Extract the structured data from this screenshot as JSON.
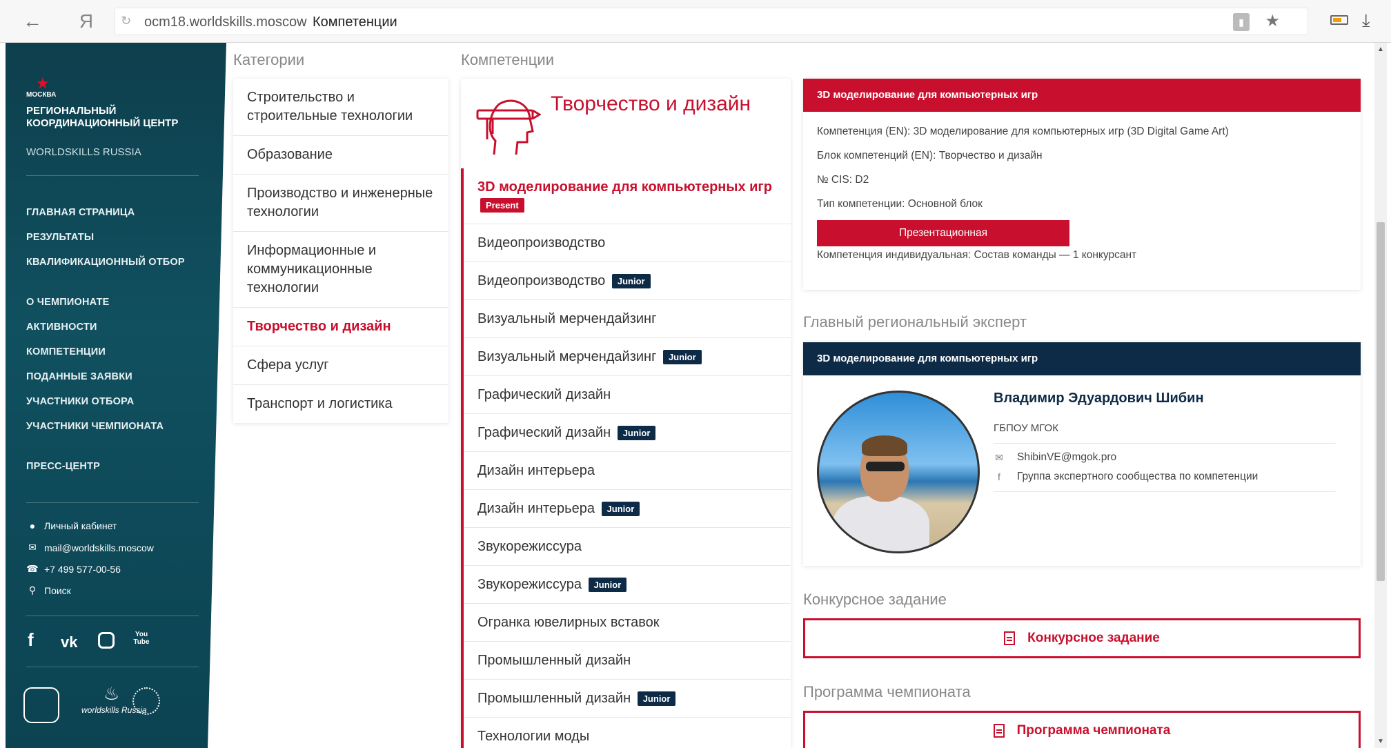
{
  "browser": {
    "back": "←",
    "ya": "Я",
    "url_host": "ocm18.worldskills.moscow",
    "url_title": "Компетенции"
  },
  "sidebar": {
    "logo_city": "МОСКВА",
    "logo_title": "РЕГИОНАЛЬНЫЙ КООРДИНАЦИОННЫЙ ЦЕНТР",
    "logo_sub": "WORLDSKILLS RUSSIA",
    "nav": [
      {
        "label": "ГЛАВНАЯ СТРАНИЦА"
      },
      {
        "label": "РЕЗУЛЬТАТЫ"
      },
      {
        "label": "КВАЛИФИКАЦИОННЫЙ ОТБОР"
      },
      {
        "label": "О ЧЕМПИОНАТЕ"
      },
      {
        "label": "АКТИВНОСТИ"
      },
      {
        "label": "КОМПЕТЕНЦИИ"
      },
      {
        "label": "ПОДАННЫЕ ЗАЯВКИ"
      },
      {
        "label": "УЧАСТНИКИ ОТБОРА"
      },
      {
        "label": "УЧАСТНИКИ ЧЕМПИОНАТА"
      },
      {
        "label": "ПРЕСС-ЦЕНТР"
      }
    ],
    "contacts": {
      "cabinet": "Личный кабинет",
      "email": "mail@worldskills.moscow",
      "phone": "+7 499 577-00-56",
      "search": "Поиск"
    },
    "social": {
      "vk": "vk",
      "youtube": "You Tube"
    },
    "ws_text": "worldskills Russia"
  },
  "categories": {
    "title": "Категории",
    "items": [
      {
        "label": "Строительство и строительные технологии"
      },
      {
        "label": "Образование"
      },
      {
        "label": "Производство и инженерные технологии"
      },
      {
        "label": "Информационные и коммуникационные технологии"
      },
      {
        "label": "Творчество и дизайн",
        "active": true
      },
      {
        "label": "Сфера услуг"
      },
      {
        "label": "Транспорт и логистика"
      }
    ]
  },
  "competencies": {
    "title": "Компетенции",
    "head_title": "Творчество и дизайн",
    "items": [
      {
        "label": "3D моделирование для компьютерных игр",
        "badge": "Present",
        "active": true
      },
      {
        "label": "Видеопроизводство"
      },
      {
        "label": "Видеопроизводство",
        "badge": "Junior"
      },
      {
        "label": "Визуальный мерчендайзинг"
      },
      {
        "label": "Визуальный мерчендайзинг",
        "badge": "Junior"
      },
      {
        "label": "Графический дизайн"
      },
      {
        "label": "Графический дизайн",
        "badge": "Junior"
      },
      {
        "label": "Дизайн интерьера"
      },
      {
        "label": "Дизайн интерьера",
        "badge": "Junior"
      },
      {
        "label": "Звукорежиссура"
      },
      {
        "label": "Звукорежиссура",
        "badge": "Junior"
      },
      {
        "label": "Огранка ювелирных вставок"
      },
      {
        "label": "Промышленный дизайн"
      },
      {
        "label": "Промышленный дизайн",
        "badge": "Junior"
      },
      {
        "label": "Технологии моды"
      }
    ]
  },
  "info": {
    "head": "3D моделирование для компьютерных игр",
    "line1": "Компетенция (EN): 3D моделирование для компьютерных игр (3D Digital Game Art)",
    "line2": "Блок компетенций (EN): Творчество и дизайн",
    "line3": "№ CIS: D2",
    "line4": "Тип компетенции: Основной блок",
    "button": "Презентационная",
    "line5": "Компетенция индивидуальная: Состав команды — 1 конкурсант"
  },
  "expert": {
    "section_title": "Главный региональный эксперт",
    "head": "3D моделирование для компьютерных игр",
    "name": "Владимир Эдуардович Шибин",
    "org": "ГБПОУ МГОК",
    "email": "ShibinVE@mgok.pro",
    "group": "Группа экспертного сообщества по компетенции"
  },
  "task": {
    "section_title": "Конкурсное задание",
    "button": "Конкурсное задание"
  },
  "program": {
    "section_title": "Программа чемпионата",
    "button": "Программа чемпионата"
  },
  "colors": {
    "accent": "#c8102e",
    "navy": "#0d2a47",
    "sidebar": "#0e3f4d"
  }
}
